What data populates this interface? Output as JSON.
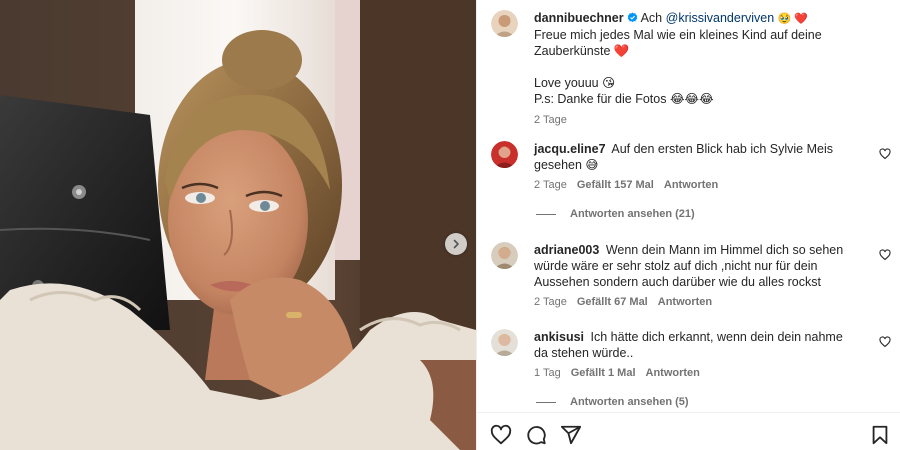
{
  "post": {
    "username": "dannibuechner",
    "text_prefix": "Ach",
    "mention": "@krissivanderviven",
    "emoji_after": "🥹 ❤️",
    "line2": "Freue mich jedes Mal wie ein kleines Kind auf deine",
    "line3": "Zauberkünste ❤️",
    "line4": "Love youuu 😘",
    "line5": "P.s: Danke für die Fotos 😂😂😂",
    "time": "2 Tage"
  },
  "comments": [
    {
      "username": "jacqu.eline7",
      "text": "Auf den ersten Blick hab ich Sylvie Meis gesehen 😅",
      "time": "2 Tage",
      "likes": "Gefällt 157 Mal",
      "reply": "Antworten",
      "view_replies": "Antworten ansehen (21)"
    },
    {
      "username": "adriane003",
      "text": "Wenn dein Mann im Himmel dich so sehen würde wäre er sehr stolz auf dich ,nicht nur für dein Aussehen sondern auch darüber wie du alles rockst",
      "time": "2 Tage",
      "likes": "Gefällt 67 Mal",
      "reply": "Antworten"
    },
    {
      "username": "ankisusi",
      "text": "Ich hätte dich erkannt, wenn dein dein nahme da stehen würde..",
      "time": "1 Tag",
      "likes": "Gefällt 1 Mal",
      "reply": "Antworten",
      "view_replies": "Antworten ansehen (5)"
    }
  ],
  "icons": {
    "like": "heart-icon",
    "comment": "comment-icon",
    "share": "share-icon",
    "save": "bookmark-icon",
    "next": "chevron-right-icon",
    "verified": "verified-badge-icon"
  },
  "colors": {
    "text": "#262626",
    "secondary": "#737373",
    "mention": "#00376b",
    "verified": "#0095f6"
  }
}
